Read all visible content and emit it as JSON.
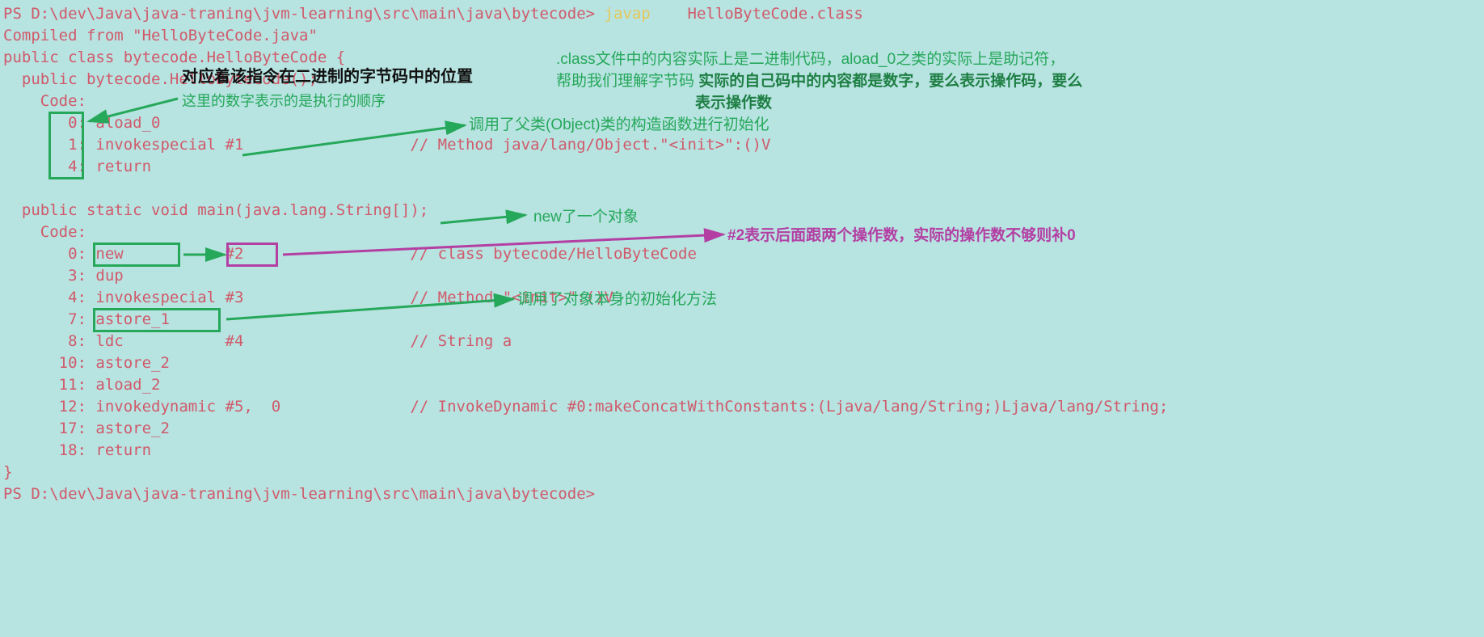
{
  "prompt1_prefix": "PS D:\\dev\\Java\\java-traning\\jvm-learning\\src\\main\\java\\bytecode> ",
  "prompt1_cmd": "javap",
  "prompt1_arg": "    HelloByteCode.class",
  "line_compiled": "Compiled from \"HelloByteCode.java\"",
  "line_class_decl": "public class bytecode.HelloByteCode {",
  "line_ctor_decl": "  public bytecode.HelloByteCode();",
  "line_code1": "    Code:",
  "ctor_0": "       0: aload_0",
  "ctor_1": "       1: invokespecial #1                  // Method java/lang/Object.\"<init>\":()V",
  "ctor_4": "       4: return",
  "blank": " ",
  "line_main_decl": "  public static void main(java.lang.String[]);",
  "line_code2": "    Code:",
  "m0": "       0: new           #2                  // class bytecode/HelloByteCode",
  "m3": "       3: dup",
  "m4": "       4: invokespecial #3                  // Method \"<init>\":()V",
  "m7": "       7: astore_1",
  "m8": "       8: ldc           #4                  // String a",
  "m10": "      10: astore_2",
  "m11": "      11: aload_2",
  "m12": "      12: invokedynamic #5,  0              // InvokeDynamic #0:makeConcatWithConstants:(Ljava/lang/String;)Ljava/lang/String;",
  "m17": "      17: astore_2",
  "m18": "      18: return",
  "line_close": "}",
  "prompt2": "PS D:\\dev\\Java\\java-traning\\jvm-learning\\src\\main\\java\\bytecode>",
  "ann_black1": "对应着该指令在二进制的字节码中的位置",
  "ann_green_exec_order": "这里的数字表示的是执行的顺序",
  "ann_green_topright1": ".class文件中的内容实际上是二进制代码，aload_0之类的实际上是助记符，",
  "ann_green_topright2": "帮助我们理解字节码 ",
  "ann_green_topright_bold1": "实际的自己码中的内容都是数字，要么表示操作码，要么",
  "ann_green_topright_bold2": "表示操作数",
  "ann_green_objinit": "调用了父类(Object)类的构造函数进行初始化",
  "ann_green_newobj": "new了一个对象",
  "ann_purple": "#2表示后面跟两个操作数，实际的操作数不够则补0",
  "ann_green_selfinit": "调用了对象本身的初始化方法",
  "colors": {
    "bg": "#b7e3e1",
    "red": "#d05a6a",
    "yellow": "#e5c85a",
    "green": "#26a85a",
    "green_bold": "#1e7f43",
    "purple": "#b33fa3",
    "black": "#111111"
  }
}
